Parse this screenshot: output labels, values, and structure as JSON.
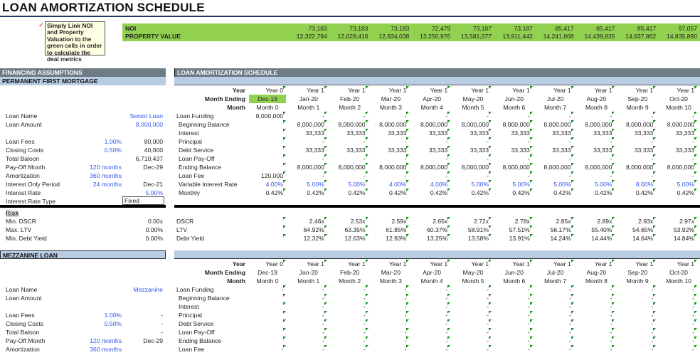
{
  "title": "LOAN AMORTIZATION SCHEDULE",
  "note": "Simply Link NOI and Property Valuation to the green cells in order to calculate the deal metrics",
  "inputs_band": {
    "noi_label": "NOI",
    "noi": [
      "73,183",
      "73,183",
      "73,183",
      "72,479",
      "73,187",
      "73,187",
      "85,417",
      "85,417",
      "85,417",
      "97,057"
    ],
    "pv_label": "PROPERTY VALUE",
    "pv": [
      "12,322,794",
      "12,628,416",
      "12,934,038",
      "13,250,976",
      "13,581,077",
      "13,911,442",
      "14,241,808",
      "14,439,835",
      "14,637,862",
      "14,835,890"
    ]
  },
  "financing": {
    "header": "FINANCING ASSUMPTIONS",
    "subheader": "PERMANENT FIRST MORTGAGE",
    "rows": [
      {
        "label": "Loan Name",
        "mid": "",
        "val": "Senior Loan",
        "blue_val": true
      },
      {
        "label": "Loan Amount",
        "mid": "",
        "val": "8,000,000",
        "blue_val": true
      },
      {
        "label": "",
        "mid": "",
        "val": ""
      },
      {
        "label": "Loan Fees",
        "mid": "1.00%",
        "val": "80,000"
      },
      {
        "label": "Closing Costs",
        "mid": "0.50%",
        "val": "40,000"
      },
      {
        "label": "Total Baloon",
        "mid": "",
        "val": "6,710,437"
      },
      {
        "label": "Pay-Off Month",
        "mid": "120 months",
        "val": "Dec-29"
      },
      {
        "label": "Amortization",
        "mid": "360 months",
        "val": ""
      },
      {
        "label": "Interest Only Period",
        "mid": "24 months",
        "val": "Dec-21"
      },
      {
        "label": "Interest Rate",
        "mid": "",
        "val": "5.00%",
        "blue_val": true
      }
    ],
    "rate_type_label": "Interest Rate Type",
    "rate_type_value": "Fixed",
    "risk": {
      "title": "Risk",
      "rows": [
        {
          "label": "Min. DSCR",
          "val": "0.00x"
        },
        {
          "label": "Max. LTV",
          "val": "0.00%"
        },
        {
          "label": "Min. Debt Yield",
          "val": "0.00%"
        }
      ]
    }
  },
  "schedule": {
    "header": "LOAN AMORTIZATION SCHEDULE",
    "year_label": "Year",
    "month_ending_label": "Month Ending",
    "month_label": "Month",
    "years": [
      "Year 0",
      "Year 1",
      "Year 1",
      "Year 1",
      "Year 1",
      "Year 1",
      "Year 1",
      "Year 1",
      "Year 1",
      "Year 1",
      "Year 1"
    ],
    "month_endings": [
      "Dec-19",
      "Jan-20",
      "Feb-20",
      "Mar-20",
      "Apr-20",
      "May-20",
      "Jun-20",
      "Jul-20",
      "Aug-20",
      "Sep-20",
      "Oct-20"
    ],
    "months": [
      "Month 0",
      "Month 1",
      "Month 2",
      "Month 3",
      "Month 4",
      "Month 5",
      "Month 6",
      "Month 7",
      "Month 8",
      "Month 9",
      "Month 10"
    ],
    "rows": [
      {
        "label": "Loan Funding",
        "values": [
          "8,000,000",
          "-",
          "-",
          "-",
          "-",
          "-",
          "-",
          "-",
          "-",
          "-",
          "-"
        ]
      },
      {
        "label": "Beginning Balance",
        "indent": true,
        "values": [
          null,
          "8,000,000",
          "8,000,000",
          "8,000,000",
          "8,000,000",
          "8,000,000",
          "8,000,000",
          "8,000,000",
          "8,000,000",
          "8,000,000",
          "8,000,000"
        ]
      },
      {
        "label": "Interest",
        "indent": true,
        "values": [
          null,
          "33,333",
          "33,333",
          "33,333",
          "33,333",
          "33,333",
          "33,333",
          "33,333",
          "33,333",
          "33,333",
          "33,333"
        ]
      },
      {
        "label": "Principal",
        "indent": true,
        "values": [
          null,
          "-",
          "-",
          "-",
          "-",
          "-",
          "-",
          "-",
          "-",
          "-",
          "-"
        ]
      },
      {
        "label": "Debt Service",
        "indent": true,
        "values": [
          null,
          "33,333",
          "33,333",
          "33,333",
          "33,333",
          "33,333",
          "33,333",
          "33,333",
          "33,333",
          "33,333",
          "33,333"
        ]
      },
      {
        "label": "Loan Pay-Off",
        "indent": true,
        "values": [
          null,
          "-",
          "-",
          "-",
          "-",
          "-",
          "-",
          "-",
          "-",
          "-",
          "-"
        ]
      },
      {
        "label": "Ending Balance",
        "indent": true,
        "values": [
          null,
          "8,000,000",
          "8,000,000",
          "8,000,000",
          "8,000,000",
          "8,000,000",
          "8,000,000",
          "8,000,000",
          "8,000,000",
          "8,000,000",
          "8,000,000"
        ]
      },
      {
        "label": "Loan Fee",
        "indent": true,
        "values": [
          "120,000",
          "-",
          "-",
          "-",
          "-",
          "-",
          "-",
          "-",
          "-",
          "-",
          "-"
        ]
      },
      {
        "label": "Variable Interest Rate",
        "indent": true,
        "blue": true,
        "values": [
          "4.00%",
          "5.00%",
          "5.00%",
          "4.00%",
          "4.00%",
          "5.00%",
          "5.00%",
          "5.00%",
          "5.00%",
          "8.00%",
          "5.00%"
        ]
      },
      {
        "label": "Monthly",
        "indent": true,
        "values": [
          "0.42%",
          "0.42%",
          "0.42%",
          "0.42%",
          "0.42%",
          "0.42%",
          "0.42%",
          "0.42%",
          "0.42%",
          "0.42%",
          "0.42%"
        ]
      }
    ],
    "metrics": [
      {
        "label": "DSCR",
        "values": [
          null,
          "2.46x",
          "2.53x",
          "2.59x",
          "2.65x",
          "2.72x",
          "2.78x",
          "2.85x",
          "2.89x",
          "2.93x",
          "2.97x"
        ]
      },
      {
        "label": "LTV",
        "values": [
          null,
          "64.92%",
          "63.35%",
          "61.85%",
          "60.37%",
          "58.91%",
          "57.51%",
          "56.17%",
          "55.40%",
          "54.65%",
          "53.92%"
        ]
      },
      {
        "label": "Debt Yield",
        "values": [
          null,
          "12.32%",
          "12.63%",
          "12.93%",
          "13.25%",
          "13.58%",
          "13.91%",
          "14.24%",
          "14.44%",
          "14.64%",
          "14.84%"
        ]
      }
    ]
  },
  "mezzanine": {
    "header": "MEZZANINE LOAN",
    "rows": [
      {
        "label": "Loan Name",
        "mid": "",
        "val": "Mezzanine",
        "blue_val": true
      },
      {
        "label": "Loan Amount",
        "mid": "",
        "val": ""
      },
      {
        "label": "",
        "mid": "",
        "val": ""
      },
      {
        "label": "Loan Fees",
        "mid": "1.00%",
        "val": "-"
      },
      {
        "label": "Closing Costs",
        "mid": "0.50%",
        "val": "-"
      },
      {
        "label": "Total Baloon",
        "mid": "",
        "val": "-"
      },
      {
        "label": "Pay-Off Month",
        "mid": "120 months",
        "val": "Dec-29"
      },
      {
        "label": "Amortization",
        "mid": "360 months",
        "val": ""
      }
    ],
    "schedule_rows": [
      {
        "label": "Loan Funding",
        "values": [
          "-",
          "-",
          "-",
          "-",
          "-",
          "-",
          "-",
          "-",
          "-",
          "-",
          "-"
        ]
      },
      {
        "label": "Beginning Balance",
        "indent": true,
        "values": [
          null,
          "-",
          "-",
          "-",
          "-",
          "-",
          "-",
          "-",
          "-",
          "-",
          "-"
        ]
      },
      {
        "label": "Interest",
        "indent": true,
        "values": [
          null,
          "-",
          "-",
          "-",
          "-",
          "-",
          "-",
          "-",
          "-",
          "-",
          "-"
        ]
      },
      {
        "label": "Principal",
        "indent": true,
        "values": [
          null,
          "-",
          "-",
          "-",
          "-",
          "-",
          "-",
          "-",
          "-",
          "-",
          "-"
        ]
      },
      {
        "label": "Debt Service",
        "indent": true,
        "values": [
          null,
          "-",
          "-",
          "-",
          "-",
          "-",
          "-",
          "-",
          "-",
          "-",
          "-"
        ]
      },
      {
        "label": "Loan Pay-Off",
        "indent": true,
        "values": [
          null,
          "-",
          "-",
          "-",
          "-",
          "-",
          "-",
          "-",
          "-",
          "-",
          "-"
        ]
      },
      {
        "label": "Ending Balance",
        "indent": true,
        "values": [
          null,
          "-",
          "-",
          "-",
          "-",
          "-",
          "-",
          "-",
          "-",
          "-",
          "-"
        ]
      },
      {
        "label": "Loan Fee",
        "indent": true,
        "values": [
          "-",
          "-",
          "-",
          "-",
          "-",
          "-",
          "-",
          "-",
          "-",
          "-",
          "-"
        ]
      }
    ]
  }
}
